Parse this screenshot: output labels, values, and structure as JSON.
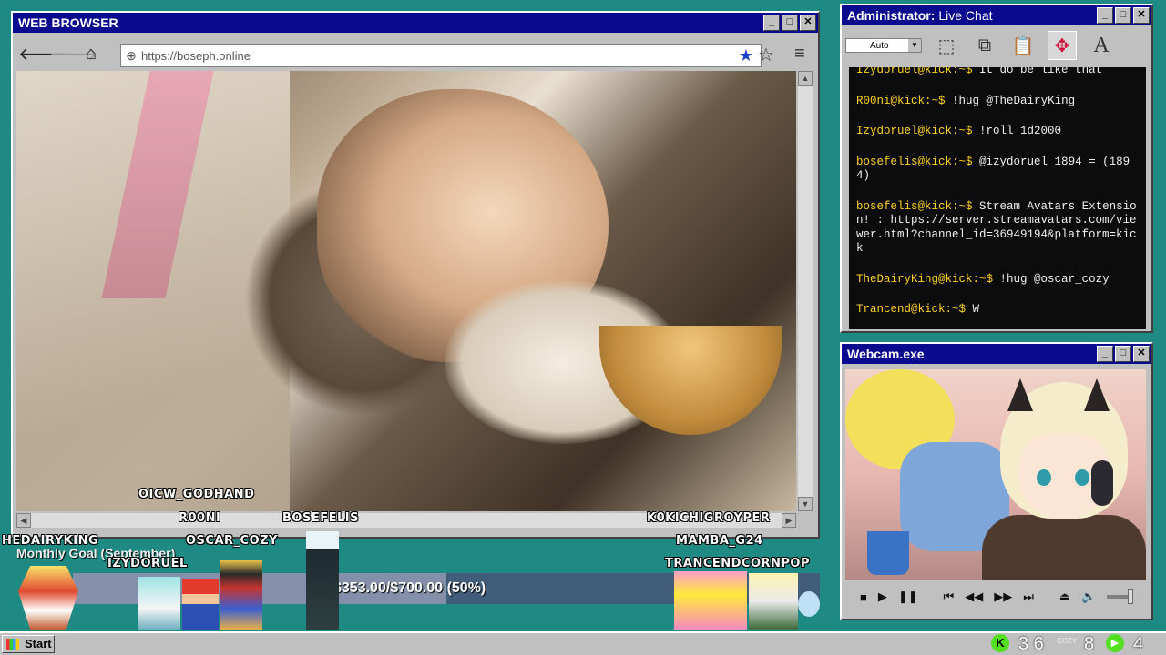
{
  "browser": {
    "title": "WEB BROWSER",
    "url": "https://boseph.online",
    "icons": [
      "back-arrow-icon",
      "forward-arrow-icon",
      "home-icon",
      "globe-icon",
      "star-filled-icon",
      "star-outline-icon",
      "hamburger-menu-icon"
    ]
  },
  "chat": {
    "title_prefix": "Administrator:",
    "title": "Live Chat",
    "auto_label": "Auto",
    "messages": [
      {
        "user": "Izydoruel@kick:~$",
        "text": "It do be like that"
      },
      {
        "user": "R00ni@kick:~$",
        "text": "!hug @TheDairyKing"
      },
      {
        "user": "Izydoruel@kick:~$",
        "text": "!roll 1d2000"
      },
      {
        "user": "bosefelis@kick:~$",
        "text": "@izydoruel 1894 = (1894)"
      },
      {
        "user": "bosefelis@kick:~$",
        "text": "Stream Avatars Extension! : https://server.streamavatars.com/viewer.html?channel_id=36949194&platform=kick"
      },
      {
        "user": "TheDairyKing@kick:~$",
        "text": "!hug @oscar_cozy"
      },
      {
        "user": "Trancend@kick:~$",
        "text": "W"
      }
    ]
  },
  "webcam": {
    "title": "Webcam.exe",
    "controls": [
      "stop-icon",
      "play-icon",
      "pause-icon",
      "skip-start-icon",
      "rewind-icon",
      "fast-forward-icon",
      "skip-end-icon",
      "eject-icon",
      "volume-icon"
    ]
  },
  "overlay": {
    "names": {
      "oicw": "OICW_GODHAND",
      "r00ni": "R00NI",
      "bosefelis": "BOSEFELIS",
      "k0kichi": "K0KICHIGROYPER",
      "hedairyking": "HEDAIRYKING",
      "oscar": "OSCAR_COZY",
      "izydoruel": "IZYDORUEL",
      "mamba": "MAMBA_G24",
      "trancend": "TRANCENDCORNPOP"
    },
    "goal": {
      "title": "Monthly Goal (September)",
      "text": "$353.00/$700.00 (50%)",
      "fraction": 0.5
    }
  },
  "taskbar": {
    "start": "Start",
    "kick_count": "3 6",
    "cozy_label": "COZY",
    "cozy_count": "8",
    "play_count": "4"
  },
  "colors": {
    "desktop": "#1e8a83",
    "titlebar": "#0a0a8f",
    "chat_username": "#ffd21f",
    "kick_green": "#52e020"
  }
}
